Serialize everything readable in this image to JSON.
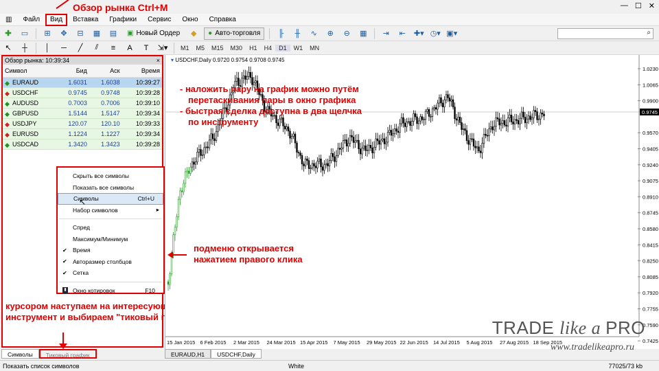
{
  "annotations": {
    "top": "Обзор рынка Ctrl+M",
    "chart1": "- наложить пару на график можно путём",
    "chart2": "перетаскивания пары в окно графика",
    "chart3": "- быстрая сделка доступна в два щелчка",
    "chart4": "по инструменту",
    "submenu1": "подменю открывается",
    "submenu2": "нажатием правого клика",
    "left1": "курсором наступаем на интересующий",
    "left2": "инструмент и выбираем \"тиковый график\""
  },
  "menu": [
    "Файл",
    "Вид",
    "Вставка",
    "Графики",
    "Сервис",
    "Окно",
    "Справка"
  ],
  "toolbar": {
    "new_order": "Новый Ордер",
    "autotrade": "Авто-торговля"
  },
  "timeframes": [
    "M1",
    "M5",
    "M15",
    "M30",
    "H1",
    "H4",
    "D1",
    "W1",
    "MN"
  ],
  "market_watch": {
    "title": "Обзор рынка: 10:39:34",
    "close": "×",
    "headers": [
      "Символ",
      "Бид",
      "Аск",
      "Время"
    ],
    "rows": [
      {
        "symbol": "EURAUD",
        "bid": "1.6031",
        "ask": "1.6038",
        "time": "10:39:27",
        "dir": "up"
      },
      {
        "symbol": "USDCHF",
        "bid": "0.9745",
        "ask": "0.9748",
        "time": "10:39:28",
        "dir": "dn"
      },
      {
        "symbol": "AUDUSD",
        "bid": "0.7003",
        "ask": "0.7006",
        "time": "10:39:10",
        "dir": "up"
      },
      {
        "symbol": "GBPUSD",
        "bid": "1.5144",
        "ask": "1.5147",
        "time": "10:39:34",
        "dir": "up"
      },
      {
        "symbol": "USDJPY",
        "bid": "120.07",
        "ask": "120.10",
        "time": "10:39:33",
        "dir": "dn"
      },
      {
        "symbol": "EURUSD",
        "bid": "1.1224",
        "ask": "1.1227",
        "time": "10:39:34",
        "dir": "dn"
      },
      {
        "symbol": "USDCAD",
        "bid": "1.3420",
        "ask": "1.3423",
        "time": "10:39:28",
        "dir": "up"
      }
    ]
  },
  "context_menu": {
    "hide_all": "Скрыть все символы",
    "show_all": "Показать все символы",
    "symbols": "Символы",
    "symbols_sc": "Ctrl+U",
    "sets": "Набор символов",
    "spread": "Спред",
    "hilo": "Максимум/Минимум",
    "time": "Время",
    "autosize": "Авторазмер столбцов",
    "grid": "Сетка",
    "quotes": "Окно котировок",
    "quotes_sc": "F10"
  },
  "tabs_left": [
    "Символы",
    "Тиковый график"
  ],
  "chart": {
    "title": "USDCHF,Daily  0.9720 0.9754 0.9708 0.9745",
    "price_labels": [
      "1.0230",
      "1.0065",
      "0.9900",
      "0.9745",
      "0.9570",
      "0.9405",
      "0.9240",
      "0.9075",
      "0.8910",
      "0.8745",
      "0.8580",
      "0.8415",
      "0.8250",
      "0.8085",
      "0.7920",
      "0.7755",
      "0.7590",
      "0.7425"
    ],
    "current_price": "0.9745",
    "date_labels": [
      "15 Jan 2015",
      "6 Feb 2015",
      "2 Mar 2015",
      "24 Mar 2015",
      "15 Apr 2015",
      "7 May 2015",
      "29 May 2015",
      "22 Jun 2015",
      "14 Jul 2015",
      "5 Aug 2015",
      "27 Aug 2015",
      "18 Sep 2015"
    ]
  },
  "chart_tabs": [
    "EURAUD,H1",
    "USDCHF,Daily"
  ],
  "status": {
    "left": "Показать список символов",
    "mid": "White",
    "right": "77025/73 kb"
  },
  "brand": {
    "t1": "TRADE ",
    "t2": "like a ",
    "t3": "PRO",
    "url": "www.tradelikeapro.ru"
  },
  "colors": {
    "accent": "#e00000",
    "up": "#209020",
    "down": "#d02020"
  }
}
